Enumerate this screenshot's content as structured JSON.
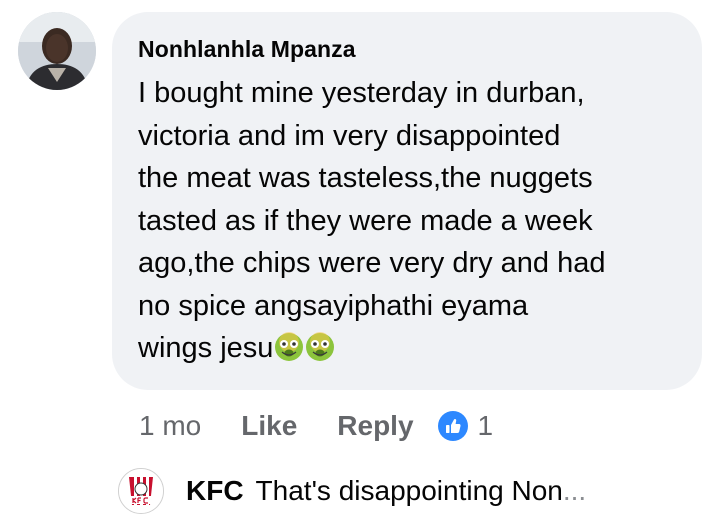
{
  "comment": {
    "author": "Nonhlanhla Mpanza",
    "text": "I bought mine yesterday in durban,\nvictoria and im very disappointed\nthe meat was tasteless,the nuggets\ntasted as if they were made a week\nago,the chips were very dry and had\nno spice angsayiphathi eyama\nwings jesu",
    "emojis": [
      "nauseated-face-icon",
      "nauseated-face-icon"
    ],
    "time": "1 mo",
    "like_label": "Like",
    "reply_label": "Reply",
    "reaction_count": "1"
  },
  "reply": {
    "author": "KFC",
    "text": "That's disappointing Non",
    "ellipsis": "..."
  },
  "colors": {
    "bubble": "#f0f2f5",
    "text": "#050505",
    "secondary": "#65676b",
    "like_blue": "#2d88ff",
    "kfc_red": "#c8102e"
  }
}
